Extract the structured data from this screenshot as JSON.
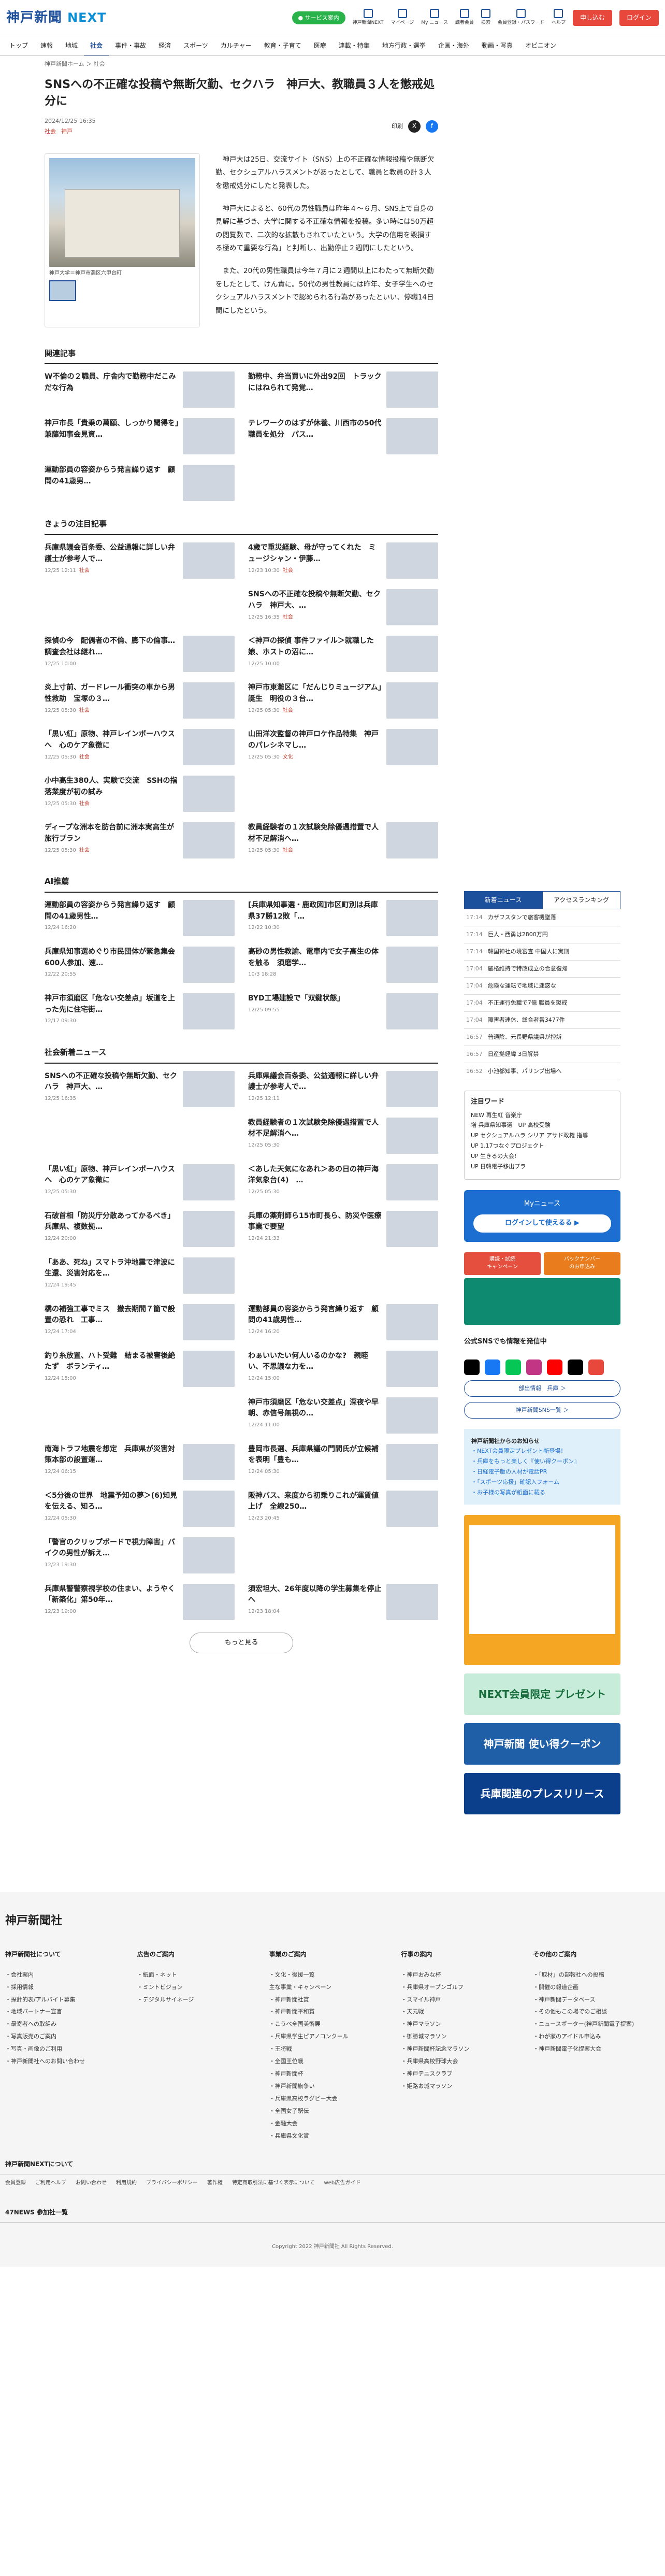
{
  "header": {
    "logo": "神戸新聞",
    "logo_next": "NEXT",
    "green": "● サービス案内",
    "icons": [
      "神戸新聞NEXT",
      "マイページ",
      "My ニュース",
      "読者会員",
      "検索",
      "会員登録・パスワード",
      "ヘルプ"
    ],
    "register": "申し込む",
    "login": "ログイン"
  },
  "nav": [
    "トップ",
    "速報",
    "地域",
    "社会",
    "事件・事故",
    "経済",
    "スポーツ",
    "カルチャー",
    "教育・子育て",
    "医療",
    "連載・特集",
    "地方行政・選挙",
    "企画・海外",
    "動画・写真",
    "オピニオン"
  ],
  "breadcrumb": "神戸新聞ホーム ＞ 社会",
  "article": {
    "title": "SNSへの不正確な投稿や無断欠勤、セクハラ　神戸大、教職員３人を懲戒処分に",
    "date": "2024/12/25 16:35",
    "tags": [
      "社会",
      "神戸"
    ],
    "print": "印刷",
    "caption": "神戸大学＝神戸市灘区六甲台町",
    "paras": [
      "神戸大は25日、交流サイト（SNS）上の不正確な情報投稿や無断欠勤、セクシュアルハラスメントがあったとして、職員と教員の計３人を懲戒処分にしたと発表した。",
      "神戸大によると、60代の男性職員は昨年４〜６月、SNS上で自身の見解に基づき、大学に関する不正確な情報を投稿。多い時には50万超の閲覧数で、二次的な拡散もされていたという。大学の信用を毀損する極めて重要な行為」と判断し、出勤停止２週間にしたという。",
      "また、20代の男性職員は今年７月に２週間以上にわたって無断欠勤をしたとして、けん責に。50代の男性教員には昨年、女子学生へのセクシュアルハラスメントで認められる行為があったといい、停職14日間にしたという。"
    ]
  },
  "related": {
    "title": "関連記事",
    "items": [
      {
        "t": "W不倫の２職員、庁舎内で勤務中だこみだな行為"
      },
      {
        "t": "勤務中、弁当買いに外出92回　トラックにはねられて発覚…"
      },
      {
        "t": "神戸市長「貴乗の萬願、しっかり聞得を」兼藤知事会見資…"
      },
      {
        "t": "テレワークのはずが休養、川西市の50代職員を処分　パス…"
      },
      {
        "t": "運動部員の容姿からう発言繰り返す　顧問の41歳男…"
      }
    ]
  },
  "attention": {
    "title": "きょうの注目記事",
    "items": [
      {
        "t": "兵庫県議会百条委、公益通報に詳しい弁護士が参考人で…",
        "d": "12/25 12:11",
        "c": "社会"
      },
      {
        "t": "4歳で重災経験、母が守ってくれた　ミュージシャン・伊藤…",
        "d": "12/23 10:30",
        "c": "社会"
      },
      {
        "t": "",
        "d": "",
        "c": ""
      },
      {
        "t": "SNSへの不正確な投稿や無断欠勤、セクハラ　神戸大、…",
        "d": "12/25 16:35",
        "c": "社会"
      },
      {
        "t": "探偵の今　配偶者の不倫、膨下の倫事…調査会社は継れ…",
        "d": "12/25 10:00",
        "c": ""
      },
      {
        "t": "＜神戸の探偵 事件ファイル＞就職した娘、ホストの沼に…",
        "d": "12/25 10:00",
        "c": ""
      },
      {
        "t": "炎上寸前、ガードレール衝突の車から男性救助　宝塚の３…",
        "d": "12/25 05:30",
        "c": "社会"
      },
      {
        "t": "神戸市東灘区に「だんじりミュージアム」誕生　明役の３台…",
        "d": "12/25 05:30",
        "c": "社会"
      },
      {
        "t": "「黒い紅」原物、神戸レインボーハウスへ　心のケア象徴に",
        "d": "12/25 05:30",
        "c": "社会"
      },
      {
        "t": "山田洋次監督の神戸ロケ作品特集　神戸のパレシネマし…",
        "d": "12/25 05:30",
        "c": "文化"
      },
      {
        "t": "小中高生380人、実験で交流　SSHの指落業度が初の試み",
        "d": "12/25 05:30",
        "c": "社会"
      },
      {
        "t": "",
        "d": "",
        "c": ""
      },
      {
        "t": "ディープな洲本を肪台前に洲本実高生が旅行プラン",
        "d": "12/25 05:30",
        "c": "社会"
      },
      {
        "t": "教員経験者の１次試験免除優遇措置で人材不足解消へ…",
        "d": "12/25 05:30",
        "c": "社会"
      }
    ]
  },
  "ai": {
    "title": "AI推薦",
    "items": [
      {
        "t": "運動部員の容姿からう発言繰り返す　顧問の41歳男性…",
        "d": "12/24 16:20"
      },
      {
        "t": "[兵庫県知事選・鹿政図]市区町別は兵庫県37勝12敗「…",
        "d": "12/22 10:30"
      },
      {
        "t": "兵庫県知事選めぐり市民団体が緊急集会 600人参加、速…",
        "d": "12/22 20:55"
      },
      {
        "t": "高砂の男性教諭、電車内で女子高生の体を触る　須磨学…",
        "d": "10/3 18:28"
      },
      {
        "t": "神戸市須磨区「危ない交差点」坂道を上った先に住宅街…",
        "d": "12/17 09:30"
      },
      {
        "t": "BYD工場建設で「双鍵状態」",
        "d": "12/25 09:55"
      }
    ]
  },
  "social": {
    "title": "社会新着ニュース",
    "items": [
      {
        "t": "SNSへの不正確な投稿や無断欠勤、セクハラ　神戸大、…",
        "d": "12/25 16:35"
      },
      {
        "t": "兵庫県議会百条委、公益通報に詳しい弁護士が参考人で…",
        "d": "12/25 12:11"
      },
      {
        "t": "",
        "d": ""
      },
      {
        "t": "教員経験者の１次試験免除優遇措置で人材不足解消へ…",
        "d": "12/25 05:30"
      },
      {
        "t": "「黒い紅」原物、神戸レインボーハウスへ　心のケア象徴に",
        "d": "12/25 05:30"
      },
      {
        "t": "＜あした天気になあれ＞あの日の神戸海洋気象台(4)　…",
        "d": "12/25 05:30"
      },
      {
        "t": "石破首相「防災庁分散あってかるべき」兵庫県、複数拠…",
        "d": "12/24 20:00"
      },
      {
        "t": "兵庫の薬剤師ら15市町長ら、防災や医療事業で要望",
        "d": "12/24 21:33"
      },
      {
        "t": "「ああ、死ね」スマトラ沖地震で津波に　生還、災害対応を…",
        "d": "12/24 19:45"
      },
      {
        "t": "",
        "d": ""
      },
      {
        "t": "橋の補強工事でミス　撤去期間７箇で設置の恐れ　工事…",
        "d": "12/24 17:04"
      },
      {
        "t": "運動部員の容姿からう発言繰り返す　顧問の41歳男性…",
        "d": "12/24 16:20"
      },
      {
        "t": "釣り糸放置、ハト受難　結まる被害後絶たず　ボランティ…",
        "d": "12/24 15:00"
      },
      {
        "t": "わぁいいたい何人いるのかな?　親睦い、不思議な力を…",
        "d": "12/24 15:00"
      },
      {
        "t": "",
        "d": ""
      },
      {
        "t": "神戸市須磨区「危ない交差点」深夜や早朝、赤信号無視の…",
        "d": "12/24 11:00"
      },
      {
        "t": "南海トラフ地震を想定　兵庫県が災害対策本部の設置運…",
        "d": "12/24 06:15"
      },
      {
        "t": "豊岡市長選、兵庫県議の門間氏が立候補を表明「豊も…",
        "d": "12/24 05:30"
      },
      {
        "t": "＜5分後の世界　地震予知の夢＞(6)知見を伝える、知ろ…",
        "d": "12/24 05:30"
      },
      {
        "t": "阪神バス、来度から初乗りこれが運賃値上げ　全線250…",
        "d": "12/23 20:45"
      },
      {
        "t": "「警官のクリップボードで視力障害」バイクの男性が訴え…",
        "d": "12/23 19:30"
      },
      {
        "t": "",
        "d": ""
      },
      {
        "t": "兵庫県警警察視学校の住まい、ようやく「新築化」第50年…",
        "d": "12/23 19:00"
      },
      {
        "t": "須宏坦大、26年度以降の学生募集を停止へ",
        "d": "12/23 18:04"
      }
    ],
    "more": "もっと見る"
  },
  "ranking": {
    "tab1": "新着ニュース",
    "tab2": "アクセスランキング",
    "items": [
      {
        "d": "17:14",
        "t": "カザフスタンで旅客機墜落"
      },
      {
        "d": "17:14",
        "t": "巨人・西勇は2800万円"
      },
      {
        "d": "17:14",
        "t": "韓国神社の境審査 中国人に実刑"
      },
      {
        "d": "17:04",
        "t": "嚴格維持で特改成立の合意復帰"
      },
      {
        "d": "17:04",
        "t": "危険な運転で地域に迷惑な"
      },
      {
        "d": "17:04",
        "t": "不正運行免職で7億 職員を懲戒"
      },
      {
        "d": "17:04",
        "t": "障害者連休、総合者番3477件"
      },
      {
        "d": "16:57",
        "t": "普通陰、元長野県議県が控訴"
      },
      {
        "d": "16:57",
        "t": "日産拠経緯 3日解禁"
      },
      {
        "d": "16:52",
        "t": "小池都知事、パリンプ出場へ"
      }
    ]
  },
  "keywords": {
    "title": "注目ワード",
    "items": [
      "NEW 再生紅 音楽庁",
      "増 兵庫県知事選　UP 高校受験",
      "UP セクシュアルハラ シリア アサド政権 指導",
      "UP 1.17つなぐプロジェクト",
      "UP 生きるの大会!",
      "UP 日韓電子移出プラ"
    ]
  },
  "mynews": {
    "title": "Myニュース",
    "btn": "ログインして使えるる ▶"
  },
  "social_follow": "公式SNSでも情報を発信中",
  "follow_btns": [
    "部出情報　兵庫 ＞",
    "神戸新聞SNS一覧 ＞"
  ],
  "notice": {
    "title": "神戸新聞社からのお知らせ",
    "links": [
      "・NEXT会員限定プレゼント新登場！",
      "・兵庫をもっと楽しく『使い得クーポン』",
      "・日経電子版の人材が電話PR",
      "・「スポーツ応援」確認入フォーム",
      "・お子様の写真が紙面に載る"
    ]
  },
  "footer": {
    "logo": "神戸新聞社",
    "cols": [
      {
        "h": "神戸新聞社について",
        "l": [
          "・会社案内",
          "・採用情報",
          "・探針的表/アルバイト募集",
          "",
          "・地域パートナー宣言",
          "・最寄者への取組み",
          "・写真販売のご案内",
          "・写真・画像のご利用",
          "・神戸新聞社へのお問い合わせ"
        ]
      },
      {
        "h": "広告のご案内",
        "l": [
          "・紙面・ネット",
          "・ミントビジョン",
          "・デジタルサイネージ"
        ]
      },
      {
        "h": "事業のご案内",
        "l": [
          "・文化・後援一覧",
          "",
          "主な事業・キャンペーン",
          "・神戸新聞社賞",
          "・神戸新聞平和賞",
          "・こうべ全国美術展",
          "・兵庫県学生ピアノコンクール",
          "・王将戦",
          "・全国王位戦",
          "・神戸新聞杯",
          "・神戸新聞旗争い",
          "・兵庫県高校ラグビー大会",
          "・全国女子駅伝",
          "・金融大会",
          "・兵庫県文化賞"
        ]
      },
      {
        "h": "行事の案内",
        "l": [
          "・神戸おみな杯",
          "・兵庫県オープンゴルフ",
          "・スマイル神戸",
          "・天元戦",
          "・神戸マラソン",
          "・御勝城マラソン",
          "・神戸新聞杯記念マラソン",
          "・兵庫県高校野球大会",
          "・神戸テニスクラブ",
          "・姫路お城マラソン"
        ]
      },
      {
        "h": "その他のご案内",
        "l": [
          "・「取材」の部報社への投稿",
          "・開催の報道企画",
          "・神戸新聞データベース",
          "・その他もこの場でのご相談",
          "・ニュースポーター(神戸新聞電子提案)",
          "・わが家のアイドル申込み",
          "・神戸新聞電子化提案大会"
        ]
      }
    ],
    "next": "神戸新聞NEXTについて",
    "next_links": [
      "会員登録",
      "ご利用ヘルプ",
      "お問い合わせ",
      "利用規約",
      "プライバシーポリシー",
      "著作権",
      "特定商取引法に基づく表示について",
      "web広告ガイド"
    ],
    "np_title": "47NEWS 参加社一覧",
    "copy": "Copyright 2022 神戸新聞社 All Rights Reserved."
  }
}
